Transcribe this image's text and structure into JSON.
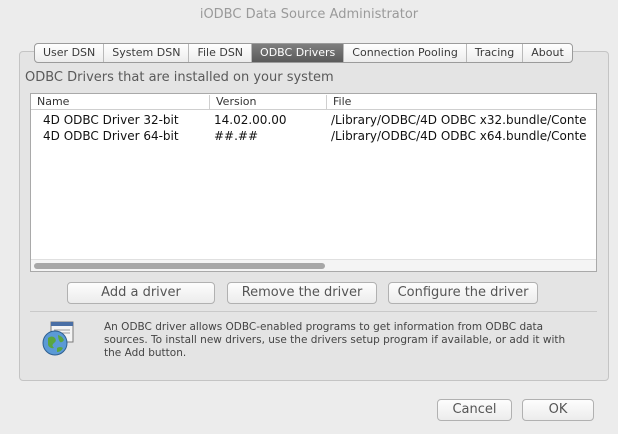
{
  "window": {
    "title": "iODBC Data Source Administrator"
  },
  "tabs": [
    {
      "label": "User DSN",
      "active": false
    },
    {
      "label": "System DSN",
      "active": false
    },
    {
      "label": "File DSN",
      "active": false
    },
    {
      "label": "ODBC Drivers",
      "active": true
    },
    {
      "label": "Connection Pooling",
      "active": false
    },
    {
      "label": "Tracing",
      "active": false
    },
    {
      "label": "About",
      "active": false
    }
  ],
  "section_label": "ODBC Drivers that are installed on your system",
  "table": {
    "columns": [
      "Name",
      "Version",
      "File"
    ],
    "rows": [
      {
        "name": "4D ODBC Driver 32-bit",
        "version": "14.02.00.00",
        "file": "/Library/ODBC/4D ODBC x32.bundle/Conte"
      },
      {
        "name": "4D ODBC Driver 64-bit",
        "version": "##.##",
        "file": "/Library/ODBC/4D ODBC x64.bundle/Conte"
      }
    ],
    "hscroll_fraction": 0.52
  },
  "buttons": {
    "add": "Add a driver",
    "remove": "Remove the driver",
    "configure": "Configure the driver",
    "cancel": "Cancel",
    "ok": "OK"
  },
  "info_text": "An ODBC driver allows ODBC-enabled programs to get information from ODBC data sources. To install new drivers, use the drivers setup program if available, or add it with the Add button.",
  "colors": {
    "active_tab": "#6a6a6a",
    "window_bg": "#ececec"
  }
}
